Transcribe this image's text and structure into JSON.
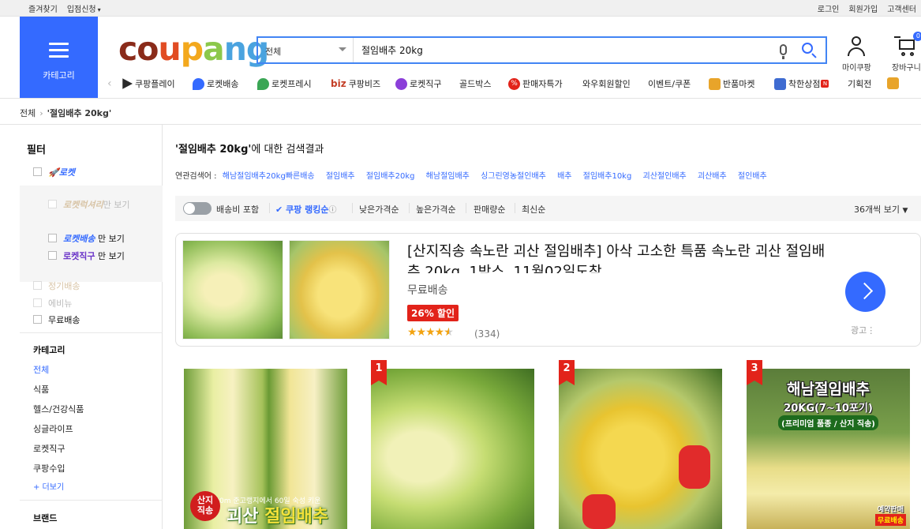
{
  "topbar": {
    "bookmark": "즐겨찾기",
    "seller": "입점신청",
    "login": "로그인",
    "signup": "회원가입",
    "cs": "고객센터"
  },
  "header": {
    "category_label": "카테고리",
    "logo": [
      "co",
      "u",
      "p",
      "a",
      "ng"
    ],
    "search": {
      "category": "전체",
      "query": "절임배추 20kg"
    },
    "mycoupang": "마이쿠팡",
    "cart": "장바구니",
    "cart_count": "0"
  },
  "nav": [
    {
      "label": "쿠팡플레이",
      "icon": "play-icon",
      "color": "#2a2a2a"
    },
    {
      "label": "로켓배송",
      "icon": "rocket-icon",
      "color": "#346aff"
    },
    {
      "label": "로켓프레시",
      "icon": "rocket-fresh-icon",
      "color": "#3aa655"
    },
    {
      "label": "쿠팡비즈",
      "icon": "biz-icon",
      "color": "#c43f27",
      "prefix": "biz"
    },
    {
      "label": "로켓직구",
      "icon": "rocket-global-icon",
      "color": "#8b3fd9"
    },
    {
      "label": "골드박스",
      "icon": "",
      "color": ""
    },
    {
      "label": "판매자특가",
      "icon": "percent-icon",
      "color": "#e2231a"
    },
    {
      "label": "와우회원할인",
      "icon": "",
      "color": ""
    },
    {
      "label": "이벤트/쿠폰",
      "icon": "",
      "color": ""
    },
    {
      "label": "반품마켓",
      "icon": "market-icon",
      "color": "#e8a42a"
    },
    {
      "label": "착한상점",
      "icon": "good-store-icon",
      "color": "#3e6bd1",
      "badge": "N"
    },
    {
      "label": "기획전",
      "icon": "",
      "color": ""
    }
  ],
  "breadcrumb": {
    "root": "전체",
    "current": "'절임배추 20kg'"
  },
  "sidebar": {
    "title": "필터",
    "rocket": "로켓",
    "rocket_merchant": "로켓럭셔리",
    "only_view": "만 보기",
    "rocket_delivery": "로켓배송",
    "rocket_global": "로켓직구",
    "subscribe": "정기배송",
    "ebay": "에비뉴",
    "free_ship": "무료배송",
    "category_title": "카테고리",
    "categories": [
      "전체",
      "식품",
      "헬스/건강식품",
      "싱글라이프",
      "로켓직구",
      "쿠팡수입"
    ],
    "more": "+ 더보기",
    "brand_title": "브랜드"
  },
  "results": {
    "query": "'절임배추 20kg'",
    "suffix": "에 대한 검색결과",
    "related_label": "연관검색어 :",
    "related": [
      "해남절임배추20kg빠른배송",
      "절임배추",
      "절임배추20kg",
      "해남절임배추",
      "싱그린영농절인배추",
      "배추",
      "절임배추10kg",
      "괴산절인배추",
      "괴산배추",
      "절인배추"
    ]
  },
  "sort": {
    "include_shipping": "배송비 포함",
    "options": [
      "쿠팡 랭킹순",
      "낮은가격순",
      "높은가격순",
      "판매량순",
      "최신순"
    ],
    "info": "ⓘ",
    "view_count": "36개씩 보기"
  },
  "ad": {
    "title": "[산지직송 속노란 괴산 절임배추] 아삭 고소한 특품 속노란 괴산 절임배추 20kg, 1박스, 11월02일도착",
    "shipping": "무료배송",
    "discount": "26% 할인",
    "stars": "★★★★★",
    "rating": 4.5,
    "review_count": "(334)",
    "ad_label": "광고"
  },
  "products": [
    {
      "rank": "",
      "caption_small": "400m 준고랭지에서 60일 숙성 키운",
      "seal": "산지\n직송",
      "caption_a": "괴산 ",
      "caption_b": "절임배추"
    },
    {
      "rank": "1"
    },
    {
      "rank": "2"
    },
    {
      "rank": "3",
      "line1": "해남절임배추",
      "line2": "20KG(7~10포기)",
      "line3": "(프리미엄 품종 / 산지 직송)",
      "stamp1": "예약판매",
      "stamp2": "무료배송"
    }
  ]
}
